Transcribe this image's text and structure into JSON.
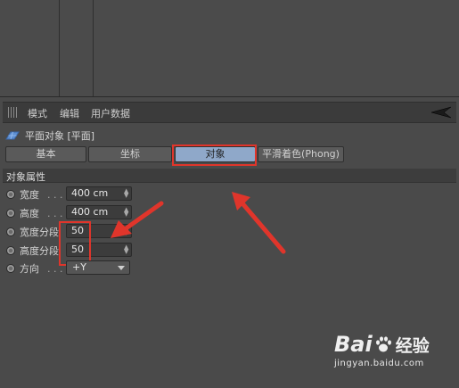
{
  "menubar": {
    "items": [
      "模式",
      "编辑",
      "用户数据"
    ]
  },
  "object": {
    "title": "平面对象 [平面]"
  },
  "tabs": [
    {
      "label": "基本",
      "active": false
    },
    {
      "label": "坐标",
      "active": false
    },
    {
      "label": "对象",
      "active": true
    },
    {
      "label": "平滑着色(Phong)",
      "active": false
    }
  ],
  "section": {
    "title": "对象属性"
  },
  "properties": [
    {
      "label": "宽度",
      "dots": ". . .",
      "value": "400 cm",
      "kind": "number"
    },
    {
      "label": "高度",
      "dots": ". . .",
      "value": "400 cm",
      "kind": "number"
    },
    {
      "label": "宽度分段",
      "dots": "",
      "value": "50",
      "kind": "number"
    },
    {
      "label": "高度分段",
      "dots": "",
      "value": "50",
      "kind": "number"
    },
    {
      "label": "方向",
      "dots": ". . .",
      "value": "+Y",
      "kind": "dropdown"
    }
  ],
  "watermark": {
    "brand_left": "Bai",
    "brand_right": "经验",
    "url": "jingyan.baidu.com"
  },
  "colors": {
    "active_tab": "#8fa8c9",
    "annotation_red": "#e0352b",
    "panel_bg": "#4a4a4a"
  }
}
